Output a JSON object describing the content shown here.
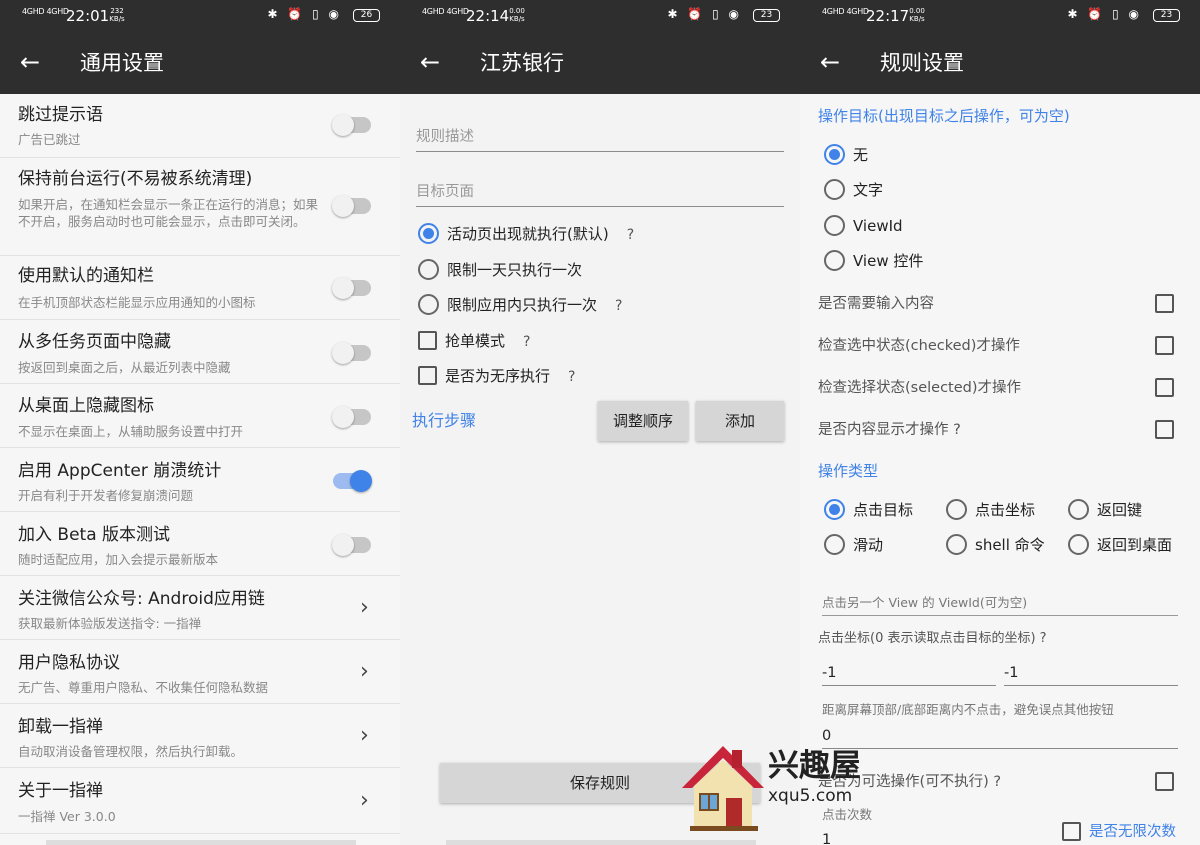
{
  "status_bars": [
    {
      "signal": "4GHD 4GHD",
      "time": "22:01",
      "speed_top": "232",
      "speed_bottom": "KB/s",
      "icons": "✱ ⏰ ▯ ◉",
      "battery": "26"
    },
    {
      "signal": "4GHD 4GHD",
      "time": "22:14",
      "speed_top": "0.00",
      "speed_bottom": "KB/s",
      "icons": "✱ ⏰ ▯ ◉",
      "battery": "23"
    },
    {
      "signal": "4GHD 4GHD",
      "time": "22:17",
      "speed_top": "0.00",
      "speed_bottom": "KB/s",
      "icons": "✱ ⏰ ▯ ◉",
      "battery": "23"
    }
  ],
  "panel1": {
    "title": "通用设置",
    "rows": [
      {
        "title": "跳过提示语",
        "sub": "广告已跳过"
      },
      {
        "title": "保持前台运行(不易被系统清理)",
        "sub": "如果开启，在通知栏会显示一条正在运行的消息；如果不开启，服务启动时也可能会显示，点击即可关闭。"
      },
      {
        "title": "使用默认的通知栏",
        "sub": "在手机顶部状态栏能显示应用通知的小图标"
      },
      {
        "title": "从多任务页面中隐藏",
        "sub": "按返回到桌面之后，从最近列表中隐藏"
      },
      {
        "title": "从桌面上隐藏图标",
        "sub": "不显示在桌面上，从辅助服务设置中打开"
      },
      {
        "title": "启用 AppCenter 崩溃统计",
        "sub": "开启有利于开发者修复崩溃问题"
      },
      {
        "title": "加入 Beta 版本测试",
        "sub": "随时适配应用，加入会提示最新版本"
      },
      {
        "title": "关注微信公众号: Android应用链",
        "sub": "获取最新体验版发送指令: 一指禅"
      },
      {
        "title": "用户隐私协议",
        "sub": "无广告、尊重用户隐私、不收集任何隐私数据"
      },
      {
        "title": "卸载一指禅",
        "sub": "自动取消设备管理权限，然后执行卸载。"
      },
      {
        "title": "关于一指禅",
        "sub": "一指禅 Ver 3.0.0"
      }
    ],
    "switch_states": [
      false,
      false,
      false,
      false,
      false,
      true,
      false
    ]
  },
  "panel2": {
    "title": "江苏银行",
    "field1_placeholder": "规则描述",
    "field2_placeholder": "目标页面",
    "radio1": "活动页出现就执行(默认)",
    "radio2": "限制一天只执行一次",
    "radio3": "限制应用内只执行一次",
    "check1": "抢单模式",
    "check2": "是否为无序执行",
    "question": "?",
    "steps_link": "执行步骤",
    "reorder_btn": "调整顺序",
    "add_btn": "添加",
    "save_btn": "保存规则"
  },
  "panel3": {
    "title": "规则设置",
    "target_header": "操作目标(出现目标之后操作，可为空)",
    "targets": [
      "无",
      "文字",
      "ViewId",
      "View 控件"
    ],
    "checks": [
      "是否需要输入内容",
      "检查选中状态(checked)才操作",
      "检查选择状态(selected)才操作",
      "是否内容显示才操作  ?"
    ],
    "type_header": "操作类型",
    "types": [
      "点击目标",
      "点击坐标",
      "返回键",
      "滑动",
      "shell 命令",
      "返回到桌面"
    ],
    "viewid_placeholder": "点击另一个 View 的 ViewId(可为空)",
    "coord_label": "点击坐标(0 表示读取点击目标的坐标)  ?",
    "coord_x": "-1",
    "coord_y": "-1",
    "distance_label": "距离屏幕顶部/底部距离内不点击，避免误点其他按钮",
    "distance_value": "0",
    "optional_label": "是否为可选操作(可不执行)  ?",
    "click_count_label": "点击次数",
    "click_count_value": "1",
    "unlimited_label": "是否无限次数"
  },
  "watermark": {
    "brand": "兴趣屋",
    "site": "xqu5.com"
  },
  "colors": {
    "accent": "#3f82e8",
    "appbar": "#2e2e2e"
  }
}
